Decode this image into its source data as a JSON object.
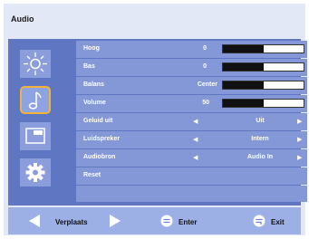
{
  "title": "Audio",
  "menu": {
    "rows": [
      {
        "label": "Hoog",
        "value": "0",
        "level": 0.5
      },
      {
        "label": "Bas",
        "value": "0",
        "level": 0.5
      },
      {
        "label": "Balans",
        "value": "Center",
        "level": 0.5
      },
      {
        "label": "Volume",
        "value": "50",
        "level": 0.5
      },
      {
        "label": "Geluid uit",
        "option": "Uit"
      },
      {
        "label": "Luidspreker",
        "option": "Intern"
      },
      {
        "label": "Audiobron",
        "option": "Audio In"
      },
      {
        "label": "Reset"
      }
    ]
  },
  "arrows": {
    "left": "◀",
    "right": "▶"
  },
  "footer": {
    "move_label": "Verplaats",
    "enter_label": "Enter",
    "exit_label": "Exit"
  },
  "side_icons": [
    "brightness-icon",
    "music-note-icon",
    "display-icon",
    "gear-icon"
  ],
  "colors": {
    "panel_bg": "#5f76c2",
    "row_bg": "#8497d6",
    "highlight": "#f3b23a",
    "footer_bg": "#9db0e6",
    "window_bg": "#e3e8f6"
  }
}
